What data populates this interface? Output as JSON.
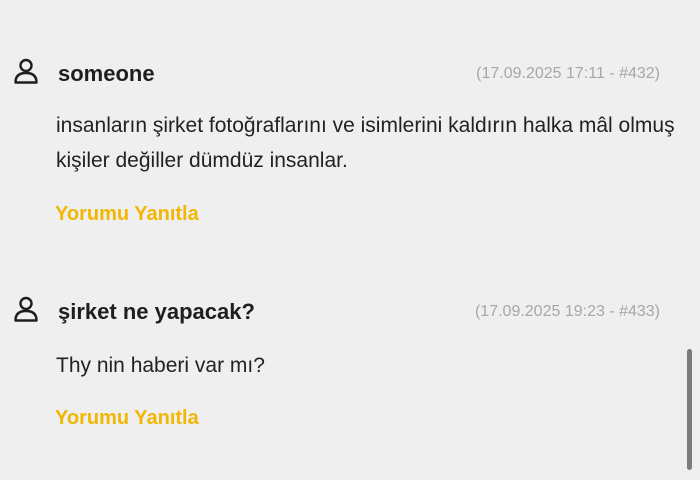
{
  "colors": {
    "background": "#efefef",
    "author": "#1e1e1e",
    "meta": "#a7a7a7",
    "body": "#222222",
    "reply": "#f2b705"
  },
  "comments": [
    {
      "author": "someone",
      "meta": "(17.09.2025 17:11 - #432)",
      "body": "insanların şirket fotoğraflarını ve isimlerini kaldırın halka mâl olmuş kişiler değiller dümdüz insanlar.",
      "reply_label": "Yorumu Yanıtla",
      "icon": "user-icon"
    },
    {
      "author": "şirket ne yapacak?",
      "meta": "(17.09.2025 19:23 - #433)",
      "body": "Thy nin haberi var mı?",
      "reply_label": "Yorumu Yanıtla",
      "icon": "user-icon"
    }
  ]
}
